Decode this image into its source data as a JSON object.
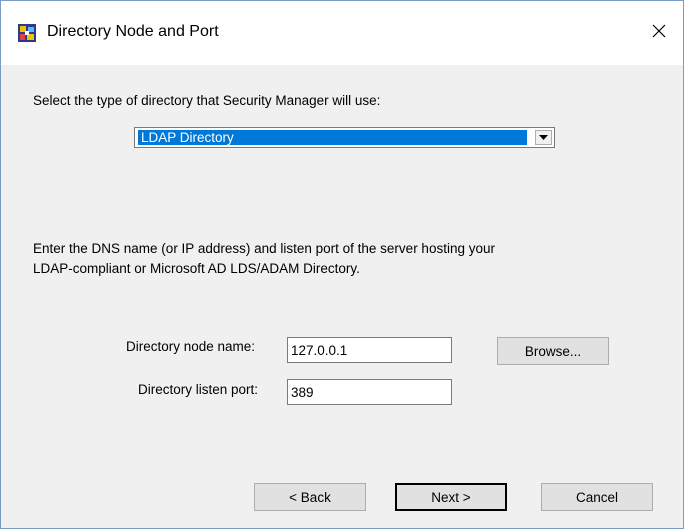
{
  "window": {
    "title": "Directory Node and Port"
  },
  "directory_type": {
    "prompt": "Select the type of directory that Security Manager will use:",
    "selected": "LDAP Directory"
  },
  "instructions": {
    "line1": "Enter the DNS name (or IP address) and listen port of the server hosting your",
    "line2": "LDAP-compliant or Microsoft AD LDS/ADAM Directory."
  },
  "fields": {
    "node_name_label": "Directory node name:",
    "node_name_value": "127.0.0.1",
    "listen_port_label": "Directory listen port:",
    "listen_port_value": "389"
  },
  "buttons": {
    "browse": "Browse...",
    "back": "< Back",
    "next": "Next >",
    "cancel": "Cancel"
  }
}
